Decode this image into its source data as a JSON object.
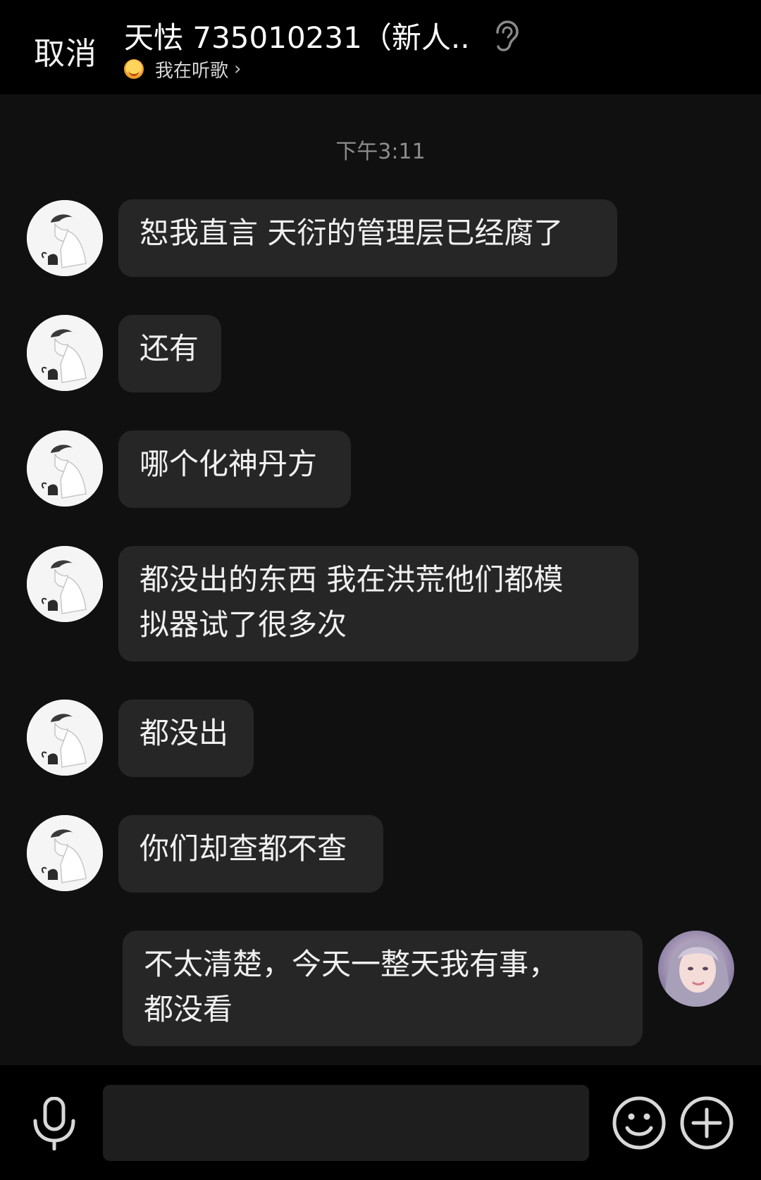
{
  "header": {
    "cancel_label": "取消",
    "title": "天怯 735010231（新人...",
    "status_text": "我在听歌",
    "status_chevron": "›",
    "icons": {
      "status": "smiling-emoji-icon",
      "listen": "ear-icon"
    }
  },
  "chat": {
    "timestamp": "下午3:11",
    "messages": [
      {
        "sender": "other",
        "text": "恕我直言 天衍的管理层已经腐了"
      },
      {
        "sender": "other",
        "text": "还有"
      },
      {
        "sender": "other",
        "text": "哪个化神丹方"
      },
      {
        "sender": "other",
        "line1": "都没出的东西 我在洪荒他们都模",
        "line2": "拟器试了很多次"
      },
      {
        "sender": "other",
        "text": "都没出"
      },
      {
        "sender": "other",
        "text": "你们却查都不查"
      },
      {
        "sender": "me",
        "line1": "不太清楚，今天一整天我有事，",
        "line2": "都没看"
      }
    ]
  },
  "input_bar": {
    "placeholder": "",
    "icons": [
      "microphone-icon",
      "emoji-icon",
      "plus-icon"
    ]
  },
  "colors": {
    "background": "#101010",
    "bars": "#000000",
    "bubble": "#262626",
    "text": "#f0f0f0",
    "timestamp": "#8c8c8c"
  }
}
